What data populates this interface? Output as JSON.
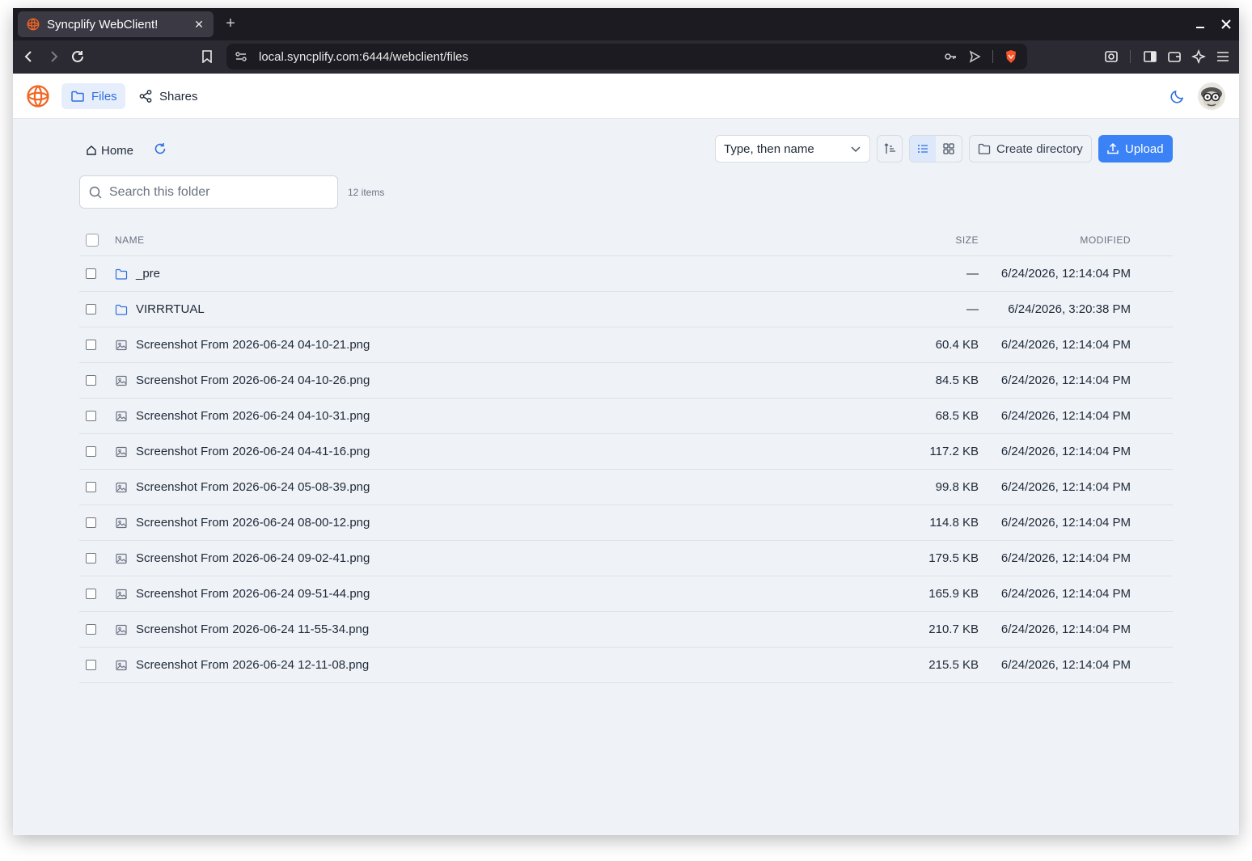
{
  "browser": {
    "tab_title": "Syncplify WebClient!",
    "url": "local.syncplify.com:6444/webclient/files"
  },
  "nav": {
    "files_label": "Files",
    "shares_label": "Shares"
  },
  "toolbar": {
    "home_label": "Home",
    "sort_value": "Type, then name",
    "create_dir_label": "Create directory",
    "upload_label": "Upload"
  },
  "search": {
    "placeholder": "Search this folder",
    "count": "12 items"
  },
  "table": {
    "headers": {
      "name": "NAME",
      "size": "SIZE",
      "modified": "MODIFIED"
    },
    "rows": [
      {
        "type": "folder",
        "name": "_pre",
        "size": "—",
        "modified": "6/24/2026, 12:14:04 PM"
      },
      {
        "type": "folder",
        "name": "VIRRRTUAL",
        "size": "—",
        "modified": "6/24/2026, 3:20:38 PM"
      },
      {
        "type": "image",
        "name": "Screenshot From 2026-06-24 04-10-21.png",
        "size": "60.4 KB",
        "modified": "6/24/2026, 12:14:04 PM"
      },
      {
        "type": "image",
        "name": "Screenshot From 2026-06-24 04-10-26.png",
        "size": "84.5 KB",
        "modified": "6/24/2026, 12:14:04 PM"
      },
      {
        "type": "image",
        "name": "Screenshot From 2026-06-24 04-10-31.png",
        "size": "68.5 KB",
        "modified": "6/24/2026, 12:14:04 PM"
      },
      {
        "type": "image",
        "name": "Screenshot From 2026-06-24 04-41-16.png",
        "size": "117.2 KB",
        "modified": "6/24/2026, 12:14:04 PM"
      },
      {
        "type": "image",
        "name": "Screenshot From 2026-06-24 05-08-39.png",
        "size": "99.8 KB",
        "modified": "6/24/2026, 12:14:04 PM"
      },
      {
        "type": "image",
        "name": "Screenshot From 2026-06-24 08-00-12.png",
        "size": "114.8 KB",
        "modified": "6/24/2026, 12:14:04 PM"
      },
      {
        "type": "image",
        "name": "Screenshot From 2026-06-24 09-02-41.png",
        "size": "179.5 KB",
        "modified": "6/24/2026, 12:14:04 PM"
      },
      {
        "type": "image",
        "name": "Screenshot From 2026-06-24 09-51-44.png",
        "size": "165.9 KB",
        "modified": "6/24/2026, 12:14:04 PM"
      },
      {
        "type": "image",
        "name": "Screenshot From 2026-06-24 11-55-34.png",
        "size": "210.7 KB",
        "modified": "6/24/2026, 12:14:04 PM"
      },
      {
        "type": "image",
        "name": "Screenshot From 2026-06-24 12-11-08.png",
        "size": "215.5 KB",
        "modified": "6/24/2026, 12:14:04 PM"
      }
    ]
  },
  "colors": {
    "accent": "#3b82f6",
    "nav_active_bg": "#e6eefc",
    "brand": "#f26522",
    "page_bg": "#eff3f8"
  }
}
